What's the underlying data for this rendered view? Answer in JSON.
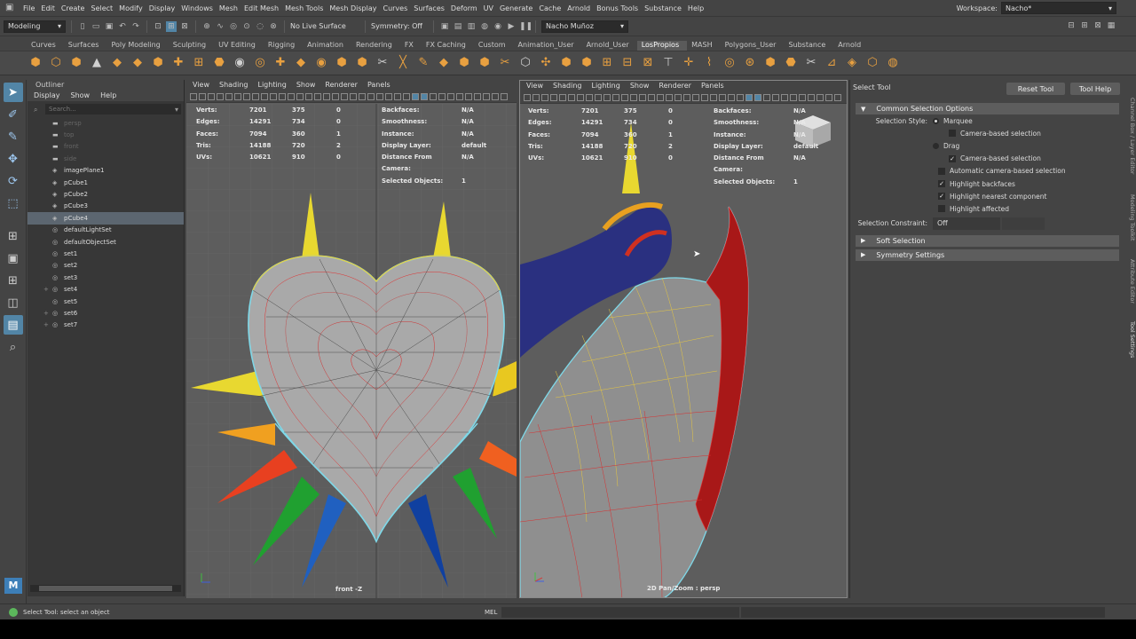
{
  "menubar": {
    "items": [
      "File",
      "Edit",
      "Create",
      "Select",
      "Modify",
      "Display",
      "Windows",
      "Mesh",
      "Edit Mesh",
      "Mesh Tools",
      "Mesh Display",
      "Curves",
      "Surfaces",
      "Deform",
      "UV",
      "Generate",
      "Cache",
      "Arnold",
      "Bonus Tools",
      "Substance",
      "Help"
    ],
    "workspace_label": "Workspace:",
    "workspace_value": "Nacho*"
  },
  "statusline": {
    "mode": "Modeling",
    "live_surface": "No Live Surface",
    "symmetry": "Symmetry: Off",
    "user": "Nacho Muñoz"
  },
  "shelf": {
    "tabs": [
      "Curves",
      "Surfaces",
      "Poly Modeling",
      "Sculpting",
      "UV Editing",
      "Rigging",
      "Animation",
      "Rendering",
      "FX",
      "FX Caching",
      "Custom",
      "Animation_User",
      "Arnold_User",
      "LosPropios",
      "MASH",
      "Polygons_User",
      "Substance",
      "Arnold"
    ],
    "active_tab": "LosPropios",
    "icon_color": "#e8a040"
  },
  "outliner": {
    "title": "Outliner",
    "menus": [
      "Display",
      "Show",
      "Help"
    ],
    "search_placeholder": "Search...",
    "items": [
      {
        "label": "persp",
        "dim": true,
        "expand": ""
      },
      {
        "label": "top",
        "dim": true,
        "expand": ""
      },
      {
        "label": "front",
        "dim": true,
        "expand": ""
      },
      {
        "label": "side",
        "dim": true,
        "expand": ""
      },
      {
        "label": "imagePlane1",
        "dim": false,
        "expand": ""
      },
      {
        "label": "pCube1",
        "dim": false,
        "expand": ""
      },
      {
        "label": "pCube2",
        "dim": false,
        "expand": ""
      },
      {
        "label": "pCube3",
        "dim": false,
        "expand": ""
      },
      {
        "label": "pCube4",
        "dim": false,
        "expand": "",
        "selected": true
      },
      {
        "label": "defaultLightSet",
        "dim": false,
        "expand": ""
      },
      {
        "label": "defaultObjectSet",
        "dim": false,
        "expand": ""
      },
      {
        "label": "set1",
        "dim": false,
        "expand": ""
      },
      {
        "label": "set2",
        "dim": false,
        "expand": ""
      },
      {
        "label": "set3",
        "dim": false,
        "expand": ""
      },
      {
        "label": "set4",
        "dim": false,
        "expand": "+"
      },
      {
        "label": "set5",
        "dim": false,
        "expand": ""
      },
      {
        "label": "set6",
        "dim": false,
        "expand": "+"
      },
      {
        "label": "set7",
        "dim": false,
        "expand": "+"
      }
    ]
  },
  "viewport_menu": [
    "View",
    "Shading",
    "Lighting",
    "Show",
    "Renderer",
    "Panels"
  ],
  "hud": {
    "labels": [
      "Verts:",
      "Edges:",
      "Faces:",
      "Tris:",
      "UVs:"
    ],
    "col1": [
      "7201",
      "14291",
      "7094",
      "14188",
      "10621"
    ],
    "col2": [
      "375",
      "734",
      "360",
      "720",
      "910"
    ],
    "col3": [
      "0",
      "0",
      "1",
      "2",
      "0"
    ],
    "right_labels": [
      "Backfaces:",
      "Smoothness:",
      "Instance:",
      "Display Layer:",
      "Distance From Camera:",
      "Selected Objects:"
    ],
    "right_values": [
      "N/A",
      "N/A",
      "N/A",
      "default",
      "N/A",
      "1"
    ]
  },
  "viewports": {
    "front_label": "front -Z",
    "persp_label": "2D Pan/Zoom : persp"
  },
  "toolpanel": {
    "title": "Select Tool",
    "reset_button": "Reset Tool",
    "help_button": "Tool Help",
    "section1": "Common Selection Options",
    "selection_style_label": "Selection Style:",
    "marquee": "Marquee",
    "camera_based_1": "Camera-based selection",
    "drag": "Drag",
    "camera_based_2": "Camera-based selection",
    "auto_camera": "Automatic camera-based selection",
    "highlight_backfaces": "Highlight backfaces",
    "highlight_nearest": "Highlight nearest component",
    "highlight_affected": "Highlight affected",
    "constraint_label": "Selection Constraint:",
    "constraint_value": "Off",
    "soft_selection": "Soft Selection",
    "symmetry_settings": "Symmetry Settings"
  },
  "sidetabs": [
    "Channel Box / Layer Editor",
    "Modeling Toolkit",
    "Attribute Editor",
    "Tool Settings"
  ],
  "helpline": {
    "text": "Select Tool: select an object",
    "mel": "MEL"
  }
}
